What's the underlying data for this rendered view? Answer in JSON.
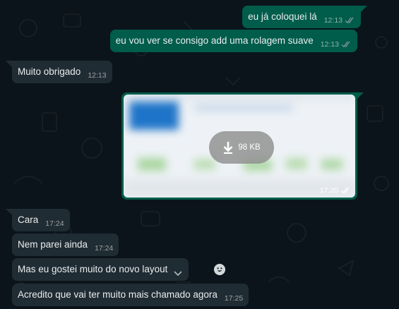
{
  "colors": {
    "background": "#0b141a",
    "outgoing_bubble": "#005c4b",
    "incoming_bubble": "#202c33",
    "text": "#e9edef",
    "read_checks": "#8696a0"
  },
  "messages": [
    {
      "direction": "out",
      "text": "eu já coloquei lá",
      "time": "12:13",
      "status": "read"
    },
    {
      "direction": "out",
      "text": "eu vou ver se consigo add uma rolagem suave",
      "time": "12:13",
      "status": "read"
    },
    {
      "direction": "in",
      "text": "Muito obrigado",
      "time": "12:13"
    },
    {
      "direction": "out",
      "type": "image",
      "download_size": "98 KB",
      "time": "17:20",
      "status": "read"
    },
    {
      "direction": "in",
      "text": "Cara",
      "time": "17:24"
    },
    {
      "direction": "in",
      "text": "Nem parei ainda",
      "time": "17:24"
    },
    {
      "direction": "in",
      "text": "Mas eu gostei muito do novo layout",
      "time": ""
    },
    {
      "direction": "in",
      "text": "Acredito que vai ter muito mais chamado agora",
      "time": "17:25"
    }
  ],
  "icons": {
    "download": "download-icon",
    "menu": "chevron-down-icon",
    "react": "emoji-icon",
    "read": "double-check-icon"
  }
}
